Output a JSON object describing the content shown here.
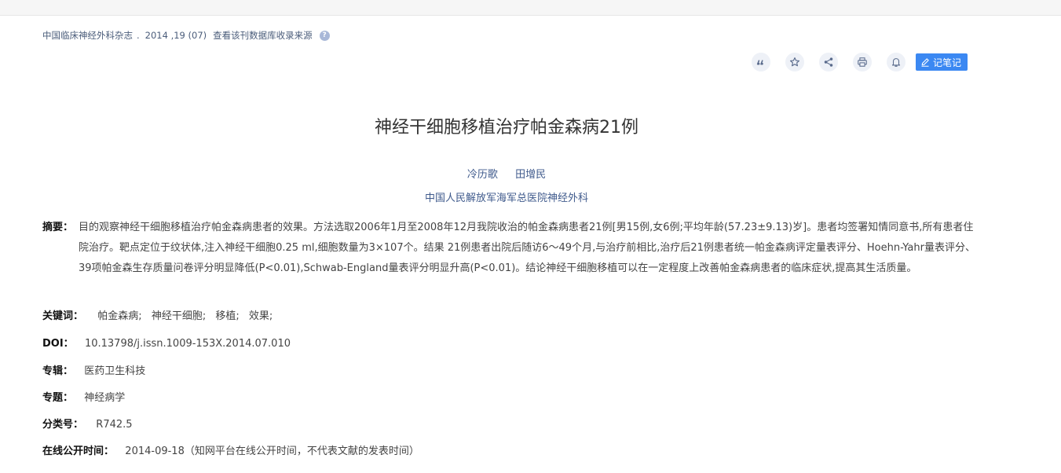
{
  "source": {
    "journal": "中国临床神经外科杂志",
    "dot": ".",
    "issue": "2014 ,19 (07)",
    "db_link": "查看该刊数据库收录来源",
    "help": "?"
  },
  "toolbar": {
    "icons": [
      "quote-icon",
      "star-icon",
      "share-icon",
      "print-icon",
      "bell-icon"
    ],
    "note_label": "记笔记"
  },
  "article": {
    "title": "神经干细胞移植治疗帕金森病21例",
    "authors": [
      "冷历歌",
      "田增民"
    ],
    "org": "中国人民解放军海军总医院神经外科"
  },
  "abstract": {
    "label": "摘要：",
    "text": "目的观察神经干细胞移植治疗帕金森病患者的效果。方法选取2006年1月至2008年12月我院收治的帕金森病患者21例[男15例,女6例;平均年龄(57.23±9.13)岁]。患者均签署知情同意书,所有患者住院治疗。靶点定位于纹状体,注入神经干细胞0.25 ml,细胞数量为3×107个。结果 21例患者出院后随访6～49个月,与治疗前相比,治疗后21例患者统一帕金森病评定量表评分、Hoehn-Yahr量表评分、39项帕金森生存质量问卷评分明显降低(P<0.01),Schwab-England量表评分明显升高(P<0.01)。结论神经干细胞移植可以在一定程度上改善帕金森病患者的临床症状,提高其生活质量。"
  },
  "keywords": {
    "label": "关键词：",
    "items": [
      "帕金森病;",
      "神经干细胞;",
      "移植;",
      "效果;"
    ]
  },
  "doi": {
    "label": "DOI：",
    "value": "10.13798/j.issn.1009-153X.2014.07.010"
  },
  "series": {
    "label": "专辑：",
    "value": "医药卫生科技"
  },
  "topic": {
    "label": "专题：",
    "value": "神经病学"
  },
  "clc": {
    "label": "分类号：",
    "value": "R742.5"
  },
  "online_date": {
    "label": "在线公开时间：",
    "value": "2014-09-18（知网平台在线公开时间，不代表文献的发表时间）"
  },
  "colors": {
    "accent": "#3b88f2",
    "link": "#3f5a8c"
  }
}
